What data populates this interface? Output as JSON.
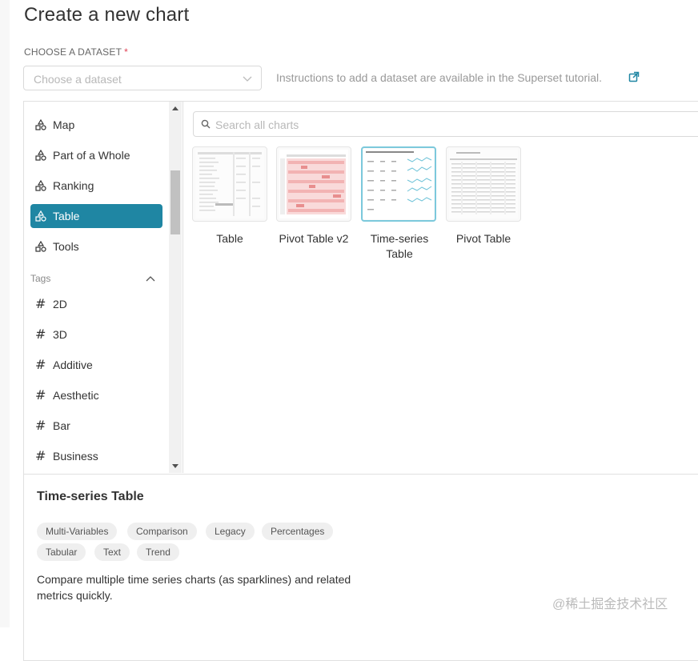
{
  "page": {
    "title": "Create a new chart"
  },
  "dataset": {
    "label": "CHOOSE A DATASET",
    "required_mark": "*",
    "placeholder": "Choose a dataset",
    "instructions": "Instructions to add a dataset are available in the Superset tutorial."
  },
  "sidebar": {
    "categories": [
      {
        "label": "Map",
        "active": false
      },
      {
        "label": "Part of a Whole",
        "active": false
      },
      {
        "label": "Ranking",
        "active": false
      },
      {
        "label": "Table",
        "active": true
      },
      {
        "label": "Tools",
        "active": false
      }
    ],
    "tags_header": "Tags",
    "tags": [
      {
        "label": "2D"
      },
      {
        "label": "3D"
      },
      {
        "label": "Additive"
      },
      {
        "label": "Aesthetic"
      },
      {
        "label": "Bar"
      },
      {
        "label": "Business"
      }
    ]
  },
  "search": {
    "placeholder": "Search all charts"
  },
  "charts": [
    {
      "label": "Table",
      "selected": false
    },
    {
      "label": "Pivot Table v2",
      "selected": false
    },
    {
      "label": "Time-series Table",
      "selected": true
    },
    {
      "label": "Pivot Table",
      "selected": false
    }
  ],
  "detail": {
    "title": "Time-series Table",
    "tags": [
      "Multi-Variables",
      "Comparison",
      "Legacy",
      "Percentages",
      "Tabular",
      "Text",
      "Trend"
    ],
    "description": "Compare multiple time series charts (as sparklines) and related metrics quickly."
  },
  "watermark": "@稀土掘金技术社区",
  "colors": {
    "accent": "#1f86a3",
    "selected_border": "#7cc9dc",
    "required": "#e04355"
  }
}
